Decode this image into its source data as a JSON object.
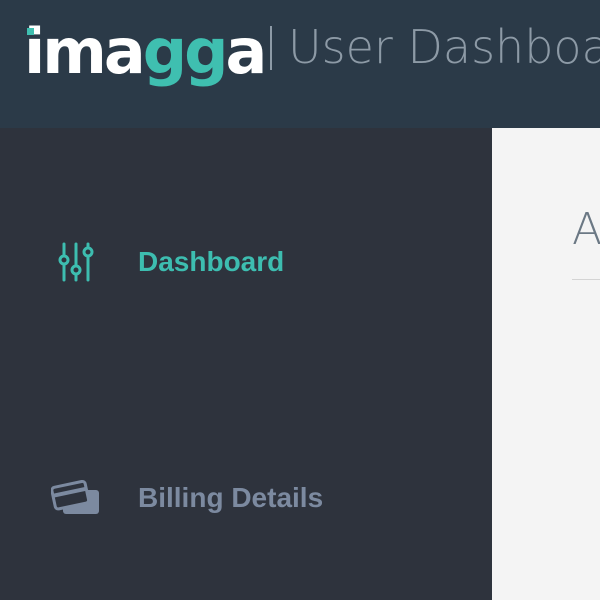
{
  "header": {
    "logo": {
      "part1": "ima",
      "part2": "gg",
      "part3": "a"
    },
    "title": "User Dashboard"
  },
  "sidebar": {
    "items": [
      {
        "label": "Dashboard",
        "icon": "sliders-icon",
        "active": true
      },
      {
        "label": "Billing Details",
        "icon": "credit-card-icon",
        "active": false
      }
    ]
  },
  "main": {
    "heading": "A"
  },
  "colors": {
    "accent": "#3dbdb0",
    "header_bg": "#2b3a48",
    "sidebar_bg": "#2e333d",
    "main_bg": "#f4f4f4",
    "inactive_text": "#7c8aa0"
  }
}
